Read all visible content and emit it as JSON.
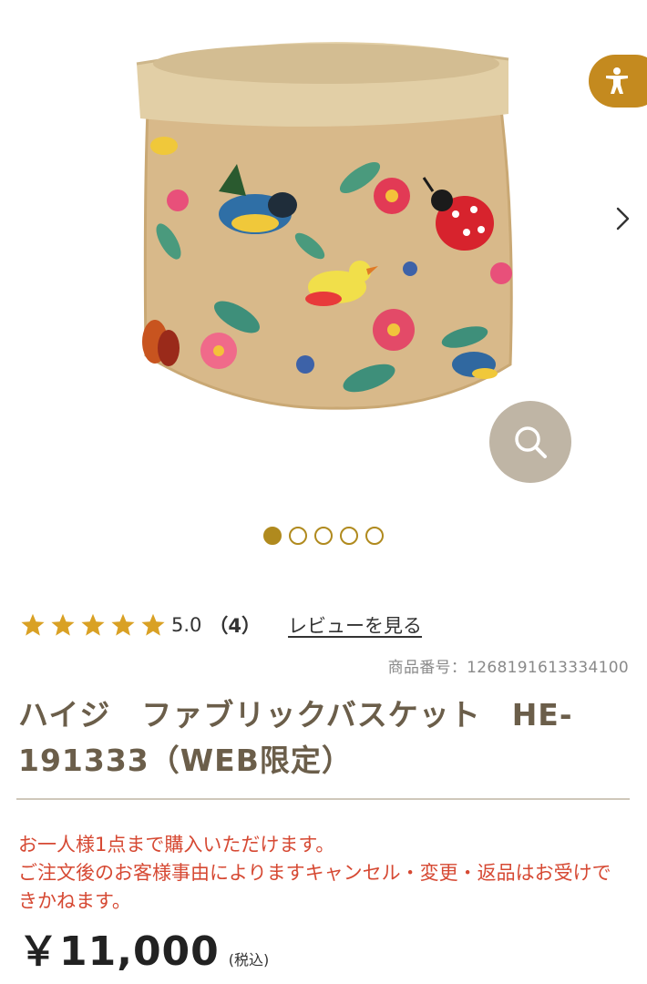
{
  "product": {
    "title": "ハイジ　ファブリックバスケット　HE-191333（WEB限定）",
    "sku_label": "商品番号：1268191613334100",
    "price": "￥11,000",
    "tax_note": "(税込)"
  },
  "gallery": {
    "image_count": 5,
    "active_index": 0,
    "image_alt": "product-photo"
  },
  "rating": {
    "stars": 5,
    "value": "5.0",
    "count": "（4）",
    "review_link": "レビューを見る"
  },
  "notice": {
    "line1": "お一人様1点まで購入いただけます。",
    "line2": "ご注文後のお客様事由によりますキャンセル・変更・返品はお受けできかねます。"
  },
  "colors": {
    "accent": "#c48a1f",
    "dot": "#b08a1e",
    "title": "#6b5e4a",
    "notice": "#d64933",
    "zoom_bg": "#bfb5a5",
    "star": "#d9a125"
  },
  "icons": {
    "accessibility": "accessibility-icon",
    "next": "chevron-right-icon",
    "zoom": "search-icon",
    "star": "star-icon"
  }
}
